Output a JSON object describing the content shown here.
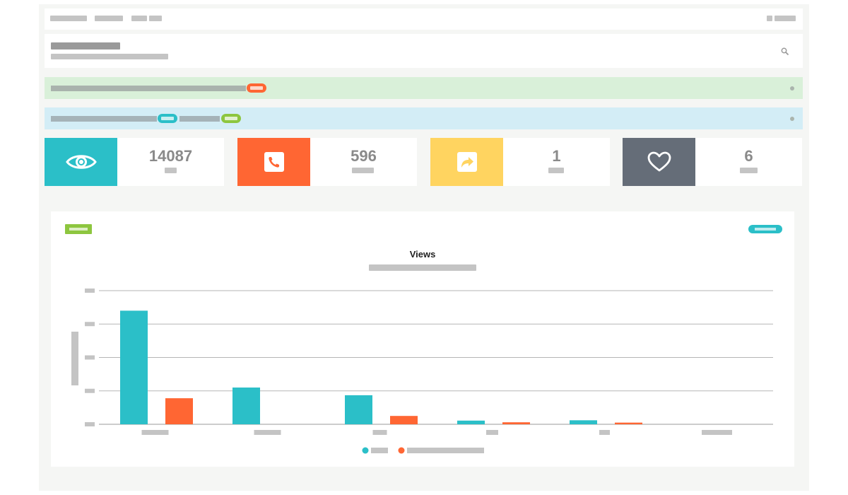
{
  "colors": {
    "teal": "#2bbfc8",
    "orange": "#ff6633",
    "yellow": "#ffd460",
    "slate": "#656d78",
    "green": "#8dc63f",
    "alert_green_bg": "#d9f0d9",
    "alert_blue_bg": "#d3edf6"
  },
  "stats": [
    {
      "value": "14087",
      "icon": "eye-icon",
      "color": "#2bbfc8"
    },
    {
      "value": "596",
      "icon": "phone-icon",
      "color": "#ff6633"
    },
    {
      "value": "1",
      "icon": "share-icon",
      "color": "#ffd460"
    },
    {
      "value": "6",
      "icon": "heart-icon",
      "color": "#656d78"
    }
  ],
  "chart_data": {
    "type": "bar",
    "title": "Views",
    "categories": [
      "",
      "",
      "",
      "",
      "",
      ""
    ],
    "series": [
      {
        "color": "#2bbfc8",
        "values": [
          3.4,
          1.1,
          0.87,
          0.11,
          0.12,
          0
        ]
      },
      {
        "color": "#ff6633",
        "values": [
          0.78,
          0,
          0.25,
          0.06,
          0.05,
          0
        ]
      }
    ],
    "ylim": [
      0,
      4
    ],
    "grid": true,
    "legend": "bottom"
  }
}
